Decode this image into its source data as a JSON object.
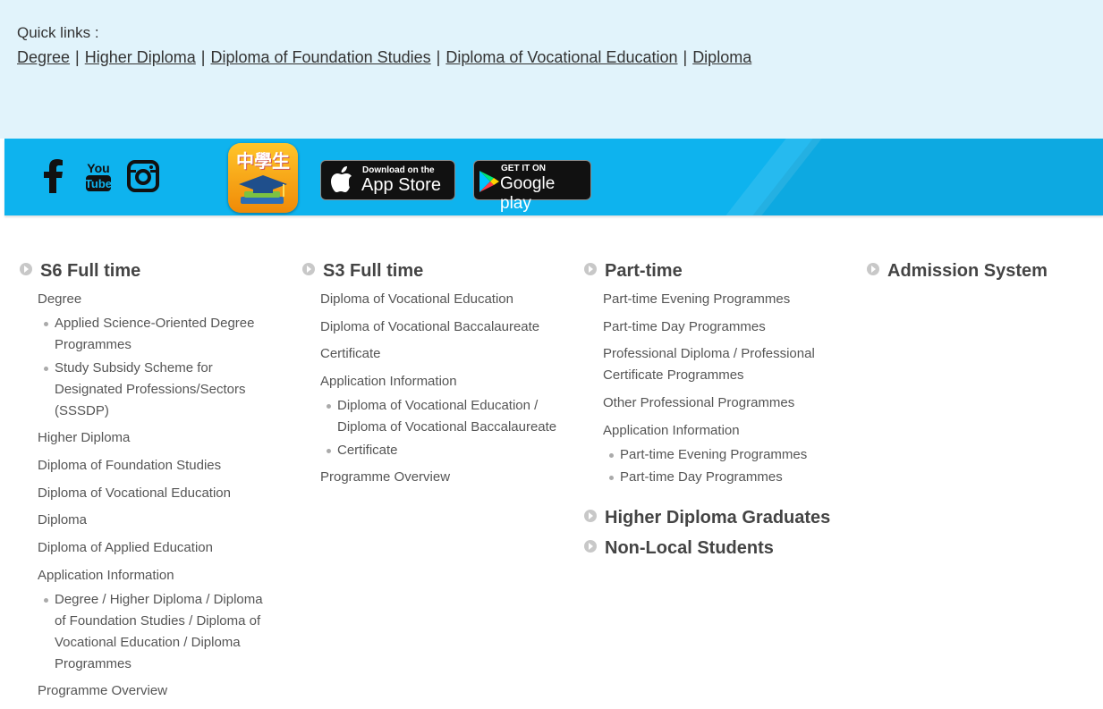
{
  "quick_links": {
    "title": "Quick links :",
    "links": [
      "Degree",
      "Higher Diploma",
      "Diploma of Foundation Studies",
      "Diploma of Vocational Education",
      "Diploma"
    ],
    "separator": "|"
  },
  "banner": {
    "social": [
      "facebook-icon",
      "youtube-icon",
      "instagram-icon"
    ],
    "app_icon_text": "中學生",
    "app_store": {
      "small": "Download on the",
      "big": "App Store"
    },
    "google_play": {
      "small": "GET IT ON",
      "big": "Google play"
    },
    "colors": {
      "band": "#0eb3ee",
      "quick_bg": "#e1f3fb"
    }
  },
  "columns": {
    "s6": {
      "heading": "S6 Full time",
      "items": {
        "degree": "Degree",
        "degree_sub1": "Applied Science-Oriented Degree Programmes",
        "degree_sub2": "Study Subsidy Scheme for Designated Professions/Sectors (SSSDP)",
        "higher_diploma": "Higher Diploma",
        "foundation": "Diploma of Foundation Studies",
        "vocational": "Diploma of Vocational Education",
        "diploma": "Diploma",
        "applied": "Diploma of Applied Education",
        "application": "Application Information",
        "application_sub": "Degree / Higher Diploma / Diploma of Foundation Studies / Diploma of Vocational Education / Diploma Programmes",
        "overview": "Programme Overview"
      }
    },
    "s3": {
      "heading": "S3 Full time",
      "items": {
        "vocational": "Diploma of Vocational Education",
        "baccalaureate": "Diploma of Vocational Baccalaureate",
        "certificate": "Certificate",
        "application": "Application Information",
        "app_sub1": "Diploma of Vocational Education / Diploma of Vocational Baccalaureate",
        "app_sub2": "Certificate",
        "overview": "Programme Overview"
      }
    },
    "part_time": {
      "heading": "Part-time",
      "items": {
        "evening": "Part-time Evening Programmes",
        "day": "Part-time Day Programmes",
        "professional": "Professional Diploma / Professional Certificate Programmes",
        "other": "Other Professional Programmes",
        "application": "Application Information",
        "app_sub1": "Part-time Evening Programmes",
        "app_sub2": "Part-time Day Programmes"
      },
      "extra_headings": [
        "Higher Diploma Graduates",
        "Non-Local Students"
      ]
    },
    "admission": {
      "heading": "Admission System"
    }
  }
}
